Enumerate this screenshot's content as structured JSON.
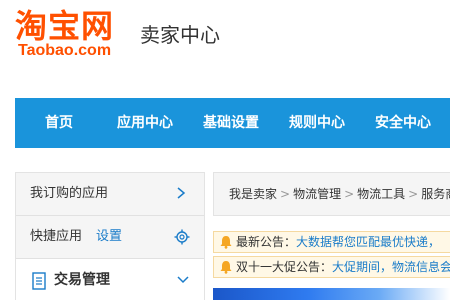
{
  "header": {
    "logo_cn": "淘宝网",
    "logo_en": "Taobao.com",
    "title": "卖家中心"
  },
  "nav": {
    "items": [
      "首页",
      "应用中心",
      "基础设置",
      "规则中心",
      "安全中心"
    ]
  },
  "sidebar": {
    "subscribed_apps": "我订购的应用",
    "quick_apps": "快捷应用",
    "settings_link": "设置",
    "trade_management": "交易管理"
  },
  "breadcrumb": [
    "我是卖家",
    "物流管理",
    "物流工具",
    "服务商"
  ],
  "notices": [
    {
      "title": "最新公告：",
      "body": "大数据帮您匹配最优快递，"
    },
    {
      "title": "双十一大促公告：",
      "body": "大促期间，物流信息会"
    }
  ],
  "colors": {
    "brand_orange": "#ff5000",
    "nav_blue": "#1a94db",
    "link_blue": "#1a7cc9"
  }
}
